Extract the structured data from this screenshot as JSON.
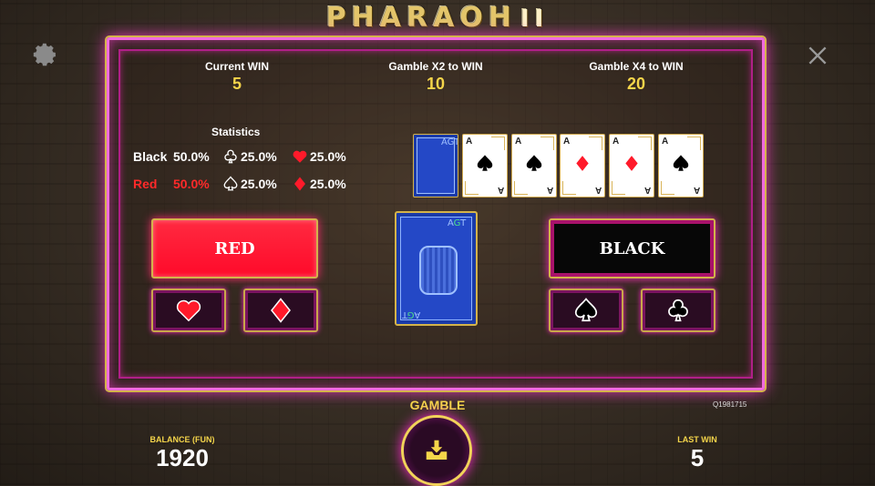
{
  "logo": {
    "text": "PHARAOH",
    "roman": "II"
  },
  "header": {
    "current_win": {
      "label": "Current WIN",
      "value": "5"
    },
    "gamble_x2": {
      "label": "Gamble X2 to WIN",
      "value": "10"
    },
    "gamble_x4": {
      "label": "Gamble X4 to WIN",
      "value": "20"
    }
  },
  "statistics": {
    "title": "Statistics",
    "black": {
      "label": "Black",
      "percent": "50.0%",
      "clubs": "25.0%",
      "hearts": "25.0%"
    },
    "red": {
      "label": "Red",
      "percent": "50.0%",
      "spades": "25.0%",
      "diamonds": "25.0%"
    }
  },
  "history": [
    {
      "type": "back",
      "brand": "AGT"
    },
    {
      "rank": "A",
      "suit": "spade"
    },
    {
      "rank": "A",
      "suit": "spade"
    },
    {
      "rank": "A",
      "suit": "diamond"
    },
    {
      "rank": "A",
      "suit": "diamond"
    },
    {
      "rank": "A",
      "suit": "spade"
    }
  ],
  "buttons": {
    "red": "RED",
    "black": "BLACK"
  },
  "deck": {
    "brand_left": "A",
    "brand_mid": "G",
    "brand_right": "T"
  },
  "footer": {
    "gamble_label": "GAMBLE",
    "round_id": "Q1981715",
    "balance_label": "BALANCE (FUN)",
    "balance_value": "1920",
    "last_win_label": "LAST WIN",
    "last_win_value": "5"
  },
  "colors": {
    "accent_gold": "#f5d54a",
    "neon_pink": "#f06adf",
    "red": "#ff0a2a"
  },
  "icons": [
    "gear-icon",
    "close-icon",
    "heart-icon",
    "diamond-icon",
    "spade-icon",
    "club-icon",
    "collect-icon"
  ]
}
